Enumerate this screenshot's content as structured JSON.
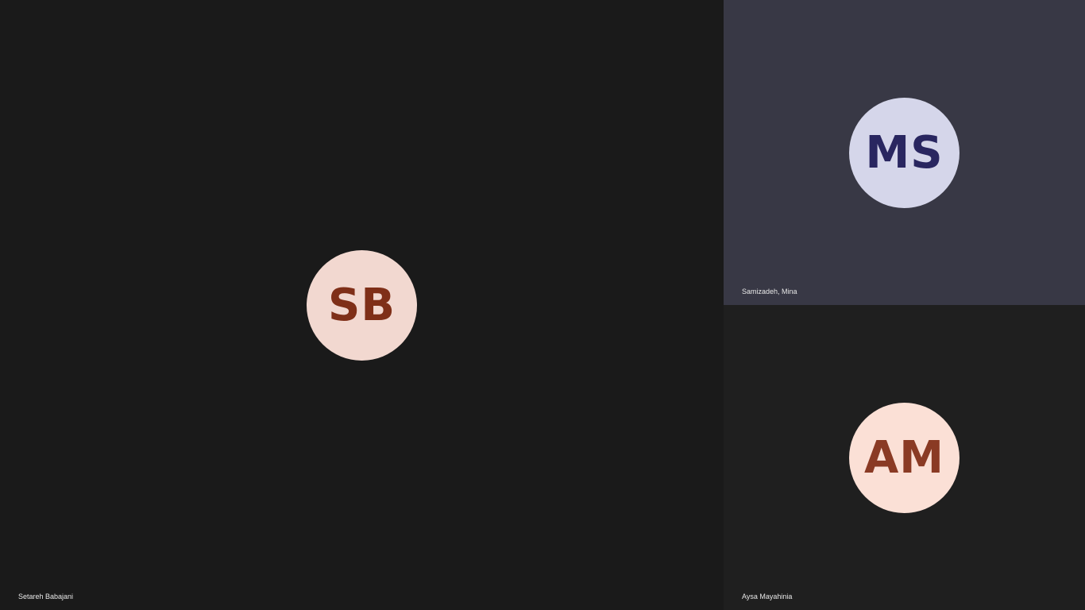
{
  "participants": [
    {
      "name": "Setareh Babajani",
      "initials": "SB",
      "tile_bg": "#1a1a1a",
      "avatar_bg": "#f2d8d0",
      "avatar_fg": "#7f2f18"
    },
    {
      "name": "Samizadeh, Mina",
      "initials": "MS",
      "tile_bg": "#383845",
      "avatar_bg": "#d5d6ea",
      "avatar_fg": "#292660"
    },
    {
      "name": "Aysa Mayahinia",
      "initials": "AM",
      "tile_bg": "#1f1f1f",
      "avatar_bg": "#fbe0d6",
      "avatar_fg": "#8a3a24"
    }
  ]
}
